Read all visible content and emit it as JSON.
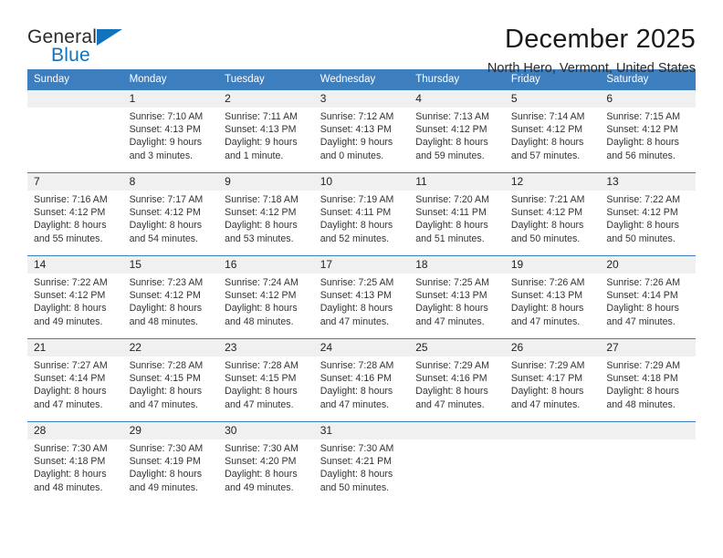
{
  "brand": {
    "word1": "General",
    "word2": "Blue",
    "accent_color": "#1273bd",
    "triangle_icon": "triangle-icon"
  },
  "header": {
    "title": "December 2025",
    "subtitle": "North Hero, Vermont, United States"
  },
  "theme": {
    "header_row_bg": "#3d7ebf",
    "day_number_bg": "#f0f0f0",
    "row_divider": "#3d7ebf",
    "text": "#333333"
  },
  "weekday_headers": [
    "Sunday",
    "Monday",
    "Tuesday",
    "Wednesday",
    "Thursday",
    "Friday",
    "Saturday"
  ],
  "labels": {
    "sunrise_prefix": "Sunrise:",
    "sunset_prefix": "Sunset:",
    "daylight_prefix": "Daylight:"
  },
  "weeks": [
    [
      {
        "day": "",
        "sunrise": "",
        "sunset": "",
        "daylight_line1": "",
        "daylight_line2": "",
        "blank": true
      },
      {
        "day": "1",
        "sunrise": "Sunrise: 7:10 AM",
        "sunset": "Sunset: 4:13 PM",
        "daylight_line1": "Daylight: 9 hours",
        "daylight_line2": "and 3 minutes."
      },
      {
        "day": "2",
        "sunrise": "Sunrise: 7:11 AM",
        "sunset": "Sunset: 4:13 PM",
        "daylight_line1": "Daylight: 9 hours",
        "daylight_line2": "and 1 minute."
      },
      {
        "day": "3",
        "sunrise": "Sunrise: 7:12 AM",
        "sunset": "Sunset: 4:13 PM",
        "daylight_line1": "Daylight: 9 hours",
        "daylight_line2": "and 0 minutes."
      },
      {
        "day": "4",
        "sunrise": "Sunrise: 7:13 AM",
        "sunset": "Sunset: 4:12 PM",
        "daylight_line1": "Daylight: 8 hours",
        "daylight_line2": "and 59 minutes."
      },
      {
        "day": "5",
        "sunrise": "Sunrise: 7:14 AM",
        "sunset": "Sunset: 4:12 PM",
        "daylight_line1": "Daylight: 8 hours",
        "daylight_line2": "and 57 minutes."
      },
      {
        "day": "6",
        "sunrise": "Sunrise: 7:15 AM",
        "sunset": "Sunset: 4:12 PM",
        "daylight_line1": "Daylight: 8 hours",
        "daylight_line2": "and 56 minutes."
      }
    ],
    [
      {
        "day": "7",
        "sunrise": "Sunrise: 7:16 AM",
        "sunset": "Sunset: 4:12 PM",
        "daylight_line1": "Daylight: 8 hours",
        "daylight_line2": "and 55 minutes."
      },
      {
        "day": "8",
        "sunrise": "Sunrise: 7:17 AM",
        "sunset": "Sunset: 4:12 PM",
        "daylight_line1": "Daylight: 8 hours",
        "daylight_line2": "and 54 minutes."
      },
      {
        "day": "9",
        "sunrise": "Sunrise: 7:18 AM",
        "sunset": "Sunset: 4:12 PM",
        "daylight_line1": "Daylight: 8 hours",
        "daylight_line2": "and 53 minutes."
      },
      {
        "day": "10",
        "sunrise": "Sunrise: 7:19 AM",
        "sunset": "Sunset: 4:11 PM",
        "daylight_line1": "Daylight: 8 hours",
        "daylight_line2": "and 52 minutes."
      },
      {
        "day": "11",
        "sunrise": "Sunrise: 7:20 AM",
        "sunset": "Sunset: 4:11 PM",
        "daylight_line1": "Daylight: 8 hours",
        "daylight_line2": "and 51 minutes."
      },
      {
        "day": "12",
        "sunrise": "Sunrise: 7:21 AM",
        "sunset": "Sunset: 4:12 PM",
        "daylight_line1": "Daylight: 8 hours",
        "daylight_line2": "and 50 minutes."
      },
      {
        "day": "13",
        "sunrise": "Sunrise: 7:22 AM",
        "sunset": "Sunset: 4:12 PM",
        "daylight_line1": "Daylight: 8 hours",
        "daylight_line2": "and 50 minutes."
      }
    ],
    [
      {
        "day": "14",
        "sunrise": "Sunrise: 7:22 AM",
        "sunset": "Sunset: 4:12 PM",
        "daylight_line1": "Daylight: 8 hours",
        "daylight_line2": "and 49 minutes."
      },
      {
        "day": "15",
        "sunrise": "Sunrise: 7:23 AM",
        "sunset": "Sunset: 4:12 PM",
        "daylight_line1": "Daylight: 8 hours",
        "daylight_line2": "and 48 minutes."
      },
      {
        "day": "16",
        "sunrise": "Sunrise: 7:24 AM",
        "sunset": "Sunset: 4:12 PM",
        "daylight_line1": "Daylight: 8 hours",
        "daylight_line2": "and 48 minutes."
      },
      {
        "day": "17",
        "sunrise": "Sunrise: 7:25 AM",
        "sunset": "Sunset: 4:13 PM",
        "daylight_line1": "Daylight: 8 hours",
        "daylight_line2": "and 47 minutes."
      },
      {
        "day": "18",
        "sunrise": "Sunrise: 7:25 AM",
        "sunset": "Sunset: 4:13 PM",
        "daylight_line1": "Daylight: 8 hours",
        "daylight_line2": "and 47 minutes."
      },
      {
        "day": "19",
        "sunrise": "Sunrise: 7:26 AM",
        "sunset": "Sunset: 4:13 PM",
        "daylight_line1": "Daylight: 8 hours",
        "daylight_line2": "and 47 minutes."
      },
      {
        "day": "20",
        "sunrise": "Sunrise: 7:26 AM",
        "sunset": "Sunset: 4:14 PM",
        "daylight_line1": "Daylight: 8 hours",
        "daylight_line2": "and 47 minutes."
      }
    ],
    [
      {
        "day": "21",
        "sunrise": "Sunrise: 7:27 AM",
        "sunset": "Sunset: 4:14 PM",
        "daylight_line1": "Daylight: 8 hours",
        "daylight_line2": "and 47 minutes."
      },
      {
        "day": "22",
        "sunrise": "Sunrise: 7:28 AM",
        "sunset": "Sunset: 4:15 PM",
        "daylight_line1": "Daylight: 8 hours",
        "daylight_line2": "and 47 minutes."
      },
      {
        "day": "23",
        "sunrise": "Sunrise: 7:28 AM",
        "sunset": "Sunset: 4:15 PM",
        "daylight_line1": "Daylight: 8 hours",
        "daylight_line2": "and 47 minutes."
      },
      {
        "day": "24",
        "sunrise": "Sunrise: 7:28 AM",
        "sunset": "Sunset: 4:16 PM",
        "daylight_line1": "Daylight: 8 hours",
        "daylight_line2": "and 47 minutes."
      },
      {
        "day": "25",
        "sunrise": "Sunrise: 7:29 AM",
        "sunset": "Sunset: 4:16 PM",
        "daylight_line1": "Daylight: 8 hours",
        "daylight_line2": "and 47 minutes."
      },
      {
        "day": "26",
        "sunrise": "Sunrise: 7:29 AM",
        "sunset": "Sunset: 4:17 PM",
        "daylight_line1": "Daylight: 8 hours",
        "daylight_line2": "and 47 minutes."
      },
      {
        "day": "27",
        "sunrise": "Sunrise: 7:29 AM",
        "sunset": "Sunset: 4:18 PM",
        "daylight_line1": "Daylight: 8 hours",
        "daylight_line2": "and 48 minutes."
      }
    ],
    [
      {
        "day": "28",
        "sunrise": "Sunrise: 7:30 AM",
        "sunset": "Sunset: 4:18 PM",
        "daylight_line1": "Daylight: 8 hours",
        "daylight_line2": "and 48 minutes."
      },
      {
        "day": "29",
        "sunrise": "Sunrise: 7:30 AM",
        "sunset": "Sunset: 4:19 PM",
        "daylight_line1": "Daylight: 8 hours",
        "daylight_line2": "and 49 minutes."
      },
      {
        "day": "30",
        "sunrise": "Sunrise: 7:30 AM",
        "sunset": "Sunset: 4:20 PM",
        "daylight_line1": "Daylight: 8 hours",
        "daylight_line2": "and 49 minutes."
      },
      {
        "day": "31",
        "sunrise": "Sunrise: 7:30 AM",
        "sunset": "Sunset: 4:21 PM",
        "daylight_line1": "Daylight: 8 hours",
        "daylight_line2": "and 50 minutes."
      },
      {
        "day": "",
        "sunrise": "",
        "sunset": "",
        "daylight_line1": "",
        "daylight_line2": "",
        "blank": true
      },
      {
        "day": "",
        "sunrise": "",
        "sunset": "",
        "daylight_line1": "",
        "daylight_line2": "",
        "blank": true
      },
      {
        "day": "",
        "sunrise": "",
        "sunset": "",
        "daylight_line1": "",
        "daylight_line2": "",
        "blank": true
      }
    ]
  ]
}
